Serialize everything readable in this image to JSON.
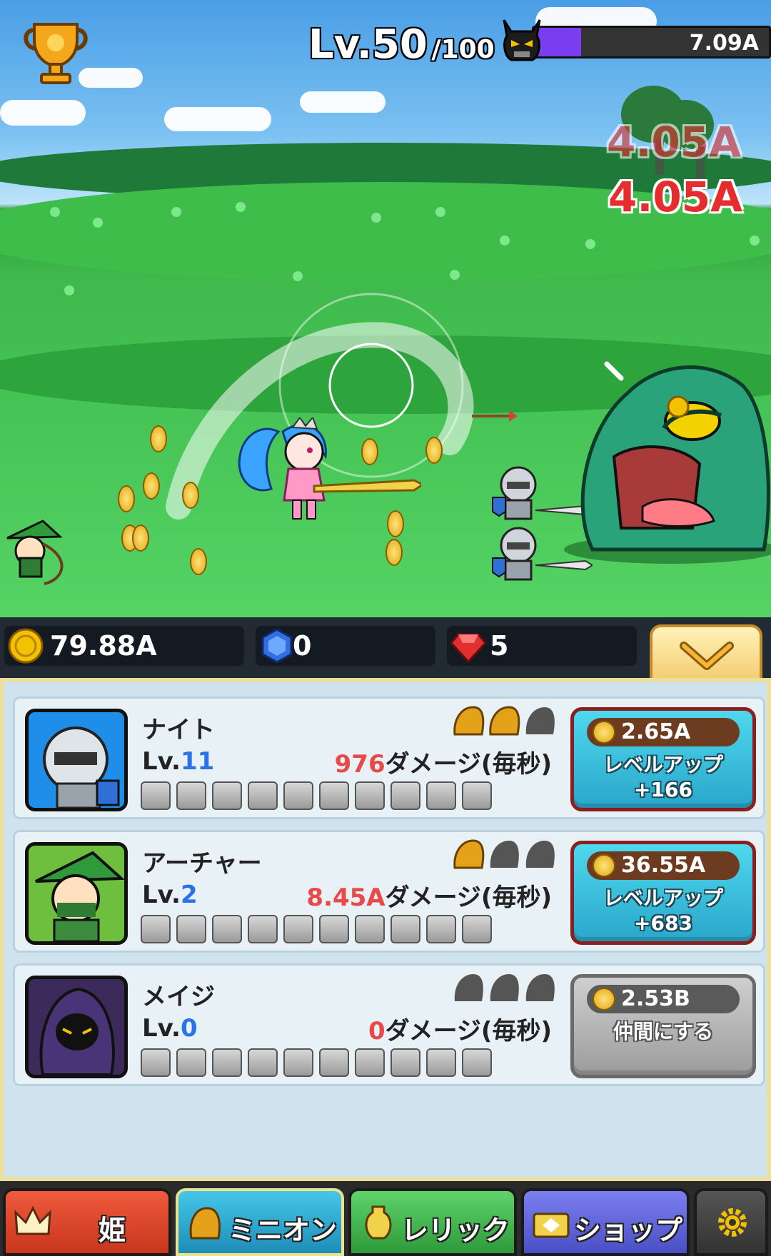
{
  "header": {
    "level_label": "Lv.",
    "level_value": "50",
    "level_max": "/100",
    "boss_hp_text": "7.09A",
    "boss_hp_fraction": 0.2
  },
  "damage_popups": [
    "4.05A",
    "4.05A"
  ],
  "resources": {
    "gold": "79.88A",
    "blue_gems": "0",
    "red_gems": "5"
  },
  "minions": [
    {
      "name": "ナイト",
      "level_prefix": "Lv.",
      "level": "11",
      "dps_value": "976",
      "dps_suffix": "ダメージ(毎秒)",
      "stars": 2,
      "button_price": "2.65A",
      "button_label": "レベルアップ",
      "button_bonus": "+166",
      "button_state": "active"
    },
    {
      "name": "アーチャー",
      "level_prefix": "Lv.",
      "level": "2",
      "dps_value": "8.45A",
      "dps_suffix": "ダメージ(毎秒)",
      "stars": 1,
      "button_price": "36.55A",
      "button_label": "レベルアップ",
      "button_bonus": "+683",
      "button_state": "active"
    },
    {
      "name": "メイジ",
      "level_prefix": "Lv.",
      "level": "0",
      "dps_value": "0",
      "dps_suffix": "ダメージ(毎秒)",
      "stars": 0,
      "button_price": "2.53B",
      "button_label": "仲間にする",
      "button_bonus": "",
      "button_state": "disabled"
    }
  ],
  "nav": {
    "princess": "姫",
    "minion": "ミニオン",
    "relic": "レリック",
    "shop": "ショップ"
  },
  "icons": {
    "trophy": "trophy-icon",
    "boss": "demon-skull-icon",
    "gold": "gold-coin-icon",
    "blue_gem": "blue-gem-icon",
    "red_gem": "ruby-icon",
    "collapse": "chevron-down-icon",
    "settings": "gear-icon"
  },
  "colors": {
    "level_number": "#2a72e8",
    "dps_number": "#e84a4a",
    "damage_popup": "#e52d2d",
    "hp_fill": "#7a3ef0"
  }
}
